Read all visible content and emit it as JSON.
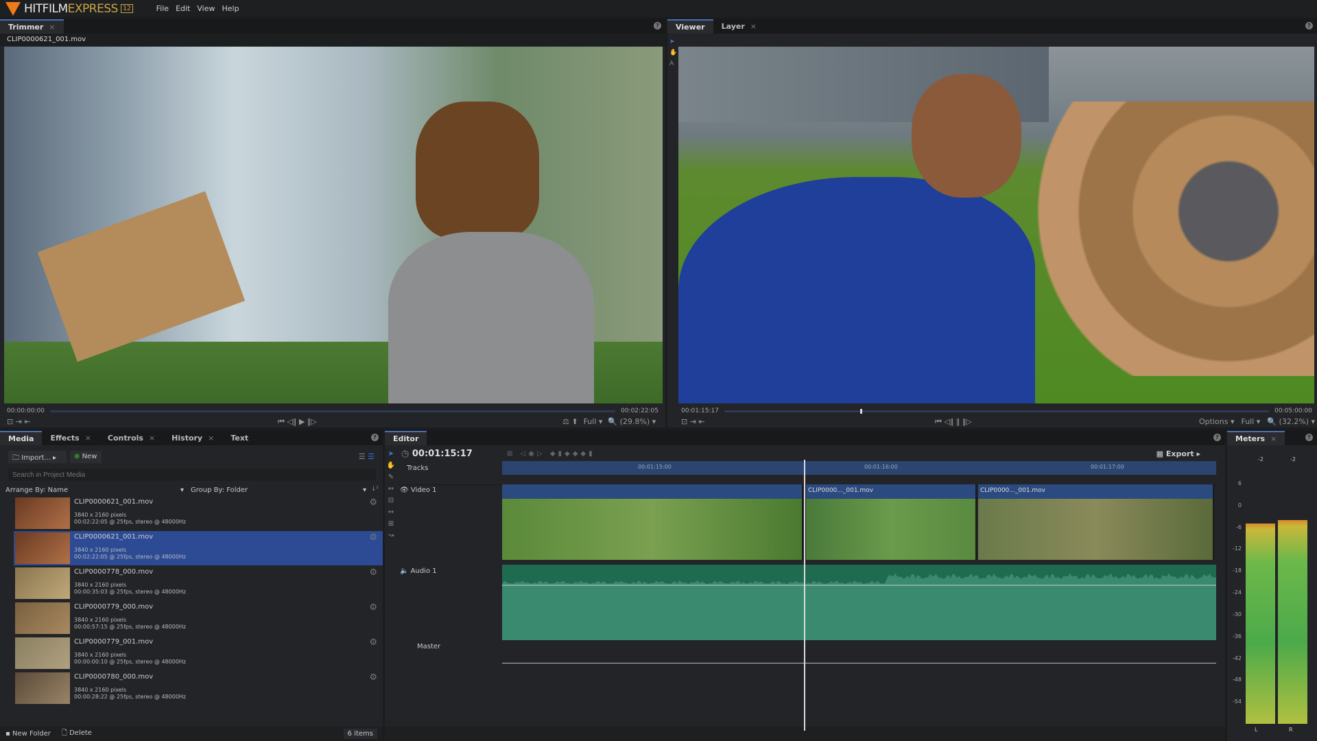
{
  "app": {
    "name_1": "HITFILM",
    "name_2": "EXPRESS",
    "version": "12"
  },
  "menu": [
    "File",
    "Edit",
    "View",
    "Help"
  ],
  "trimmer": {
    "tab": "Trimmer",
    "filename": "CLIP0000621_001.mov",
    "timecode_start": "00:00:00:00",
    "timecode_end": "00:02:22:05",
    "quality": "Full",
    "zoom": "(29.8%)",
    "playhead_fraction": 0.0
  },
  "viewer": {
    "tabs": [
      "Viewer",
      "Layer"
    ],
    "timecode": "00:01:15:17",
    "timecode_end": "00:05:00:00",
    "options": "Options",
    "quality": "Full",
    "zoom": "(32.2%)",
    "playhead_fraction": 0.25
  },
  "media_panel": {
    "tabs": [
      "Media",
      "Effects",
      "Controls",
      "History",
      "Text"
    ],
    "import_label": "Import...",
    "new_label": "New",
    "search_placeholder": "Search in Project Media",
    "arrange": "Arrange By: Name",
    "group": "Group By: Folder",
    "items": [
      {
        "name": "CLIP0000621_001.mov",
        "res": "3840 x 2160 pixels",
        "info": "00:02:22:05 @ 25fps, stereo @ 48000Hz",
        "selected": false
      },
      {
        "name": "CLIP0000621_001.mov",
        "res": "3840 x 2160 pixels",
        "info": "00:02:22:05 @ 25fps, stereo @ 48000Hz",
        "selected": true
      },
      {
        "name": "CLIP0000778_000.mov",
        "res": "3840 x 2160 pixels",
        "info": "00:00:35:03 @ 25fps, stereo @ 48000Hz",
        "selected": false
      },
      {
        "name": "CLIP0000779_000.mov",
        "res": "3840 x 2160 pixels",
        "info": "00:00:57:15 @ 25fps, stereo @ 48000Hz",
        "selected": false
      },
      {
        "name": "CLIP0000779_001.mov",
        "res": "3840 x 2160 pixels",
        "info": "00:00:00:10 @ 25fps, stereo @ 48000Hz",
        "selected": false
      },
      {
        "name": "CLIP0000780_000.mov",
        "res": "3840 x 2160 pixels",
        "info": "00:00:28:22 @ 25fps, stereo @ 48000Hz",
        "selected": false
      }
    ],
    "new_folder": "New Folder",
    "delete": "Delete",
    "count": "6 items"
  },
  "editor": {
    "tab": "Editor",
    "timecode": "00:01:15:17",
    "tracks_label": "Tracks",
    "export": "Export",
    "ruler": [
      "00:01:15:00",
      "00:01:16:00",
      "00:01:17:00"
    ],
    "video_track": "Video 1",
    "audio_track": "Audio 1",
    "master": "Master",
    "clips": [
      "",
      "CLIP0000..._001.mov",
      "CLIP0000..._001.mov"
    ]
  },
  "meters": {
    "tab": "Meters",
    "peaks": [
      "-2",
      "-2"
    ],
    "scale": [
      "6",
      "0",
      "-6",
      "-12",
      "-18",
      "-24",
      "-30",
      "-36",
      "-42",
      "-48",
      "-54"
    ],
    "channels": [
      "L",
      "R"
    ],
    "levels_db": [
      -5,
      -4
    ]
  },
  "colors": {
    "accent": "#4a6fb5",
    "selection": "#2c4b94",
    "audio": "#1f6b50",
    "logo": "#f07a1a"
  }
}
